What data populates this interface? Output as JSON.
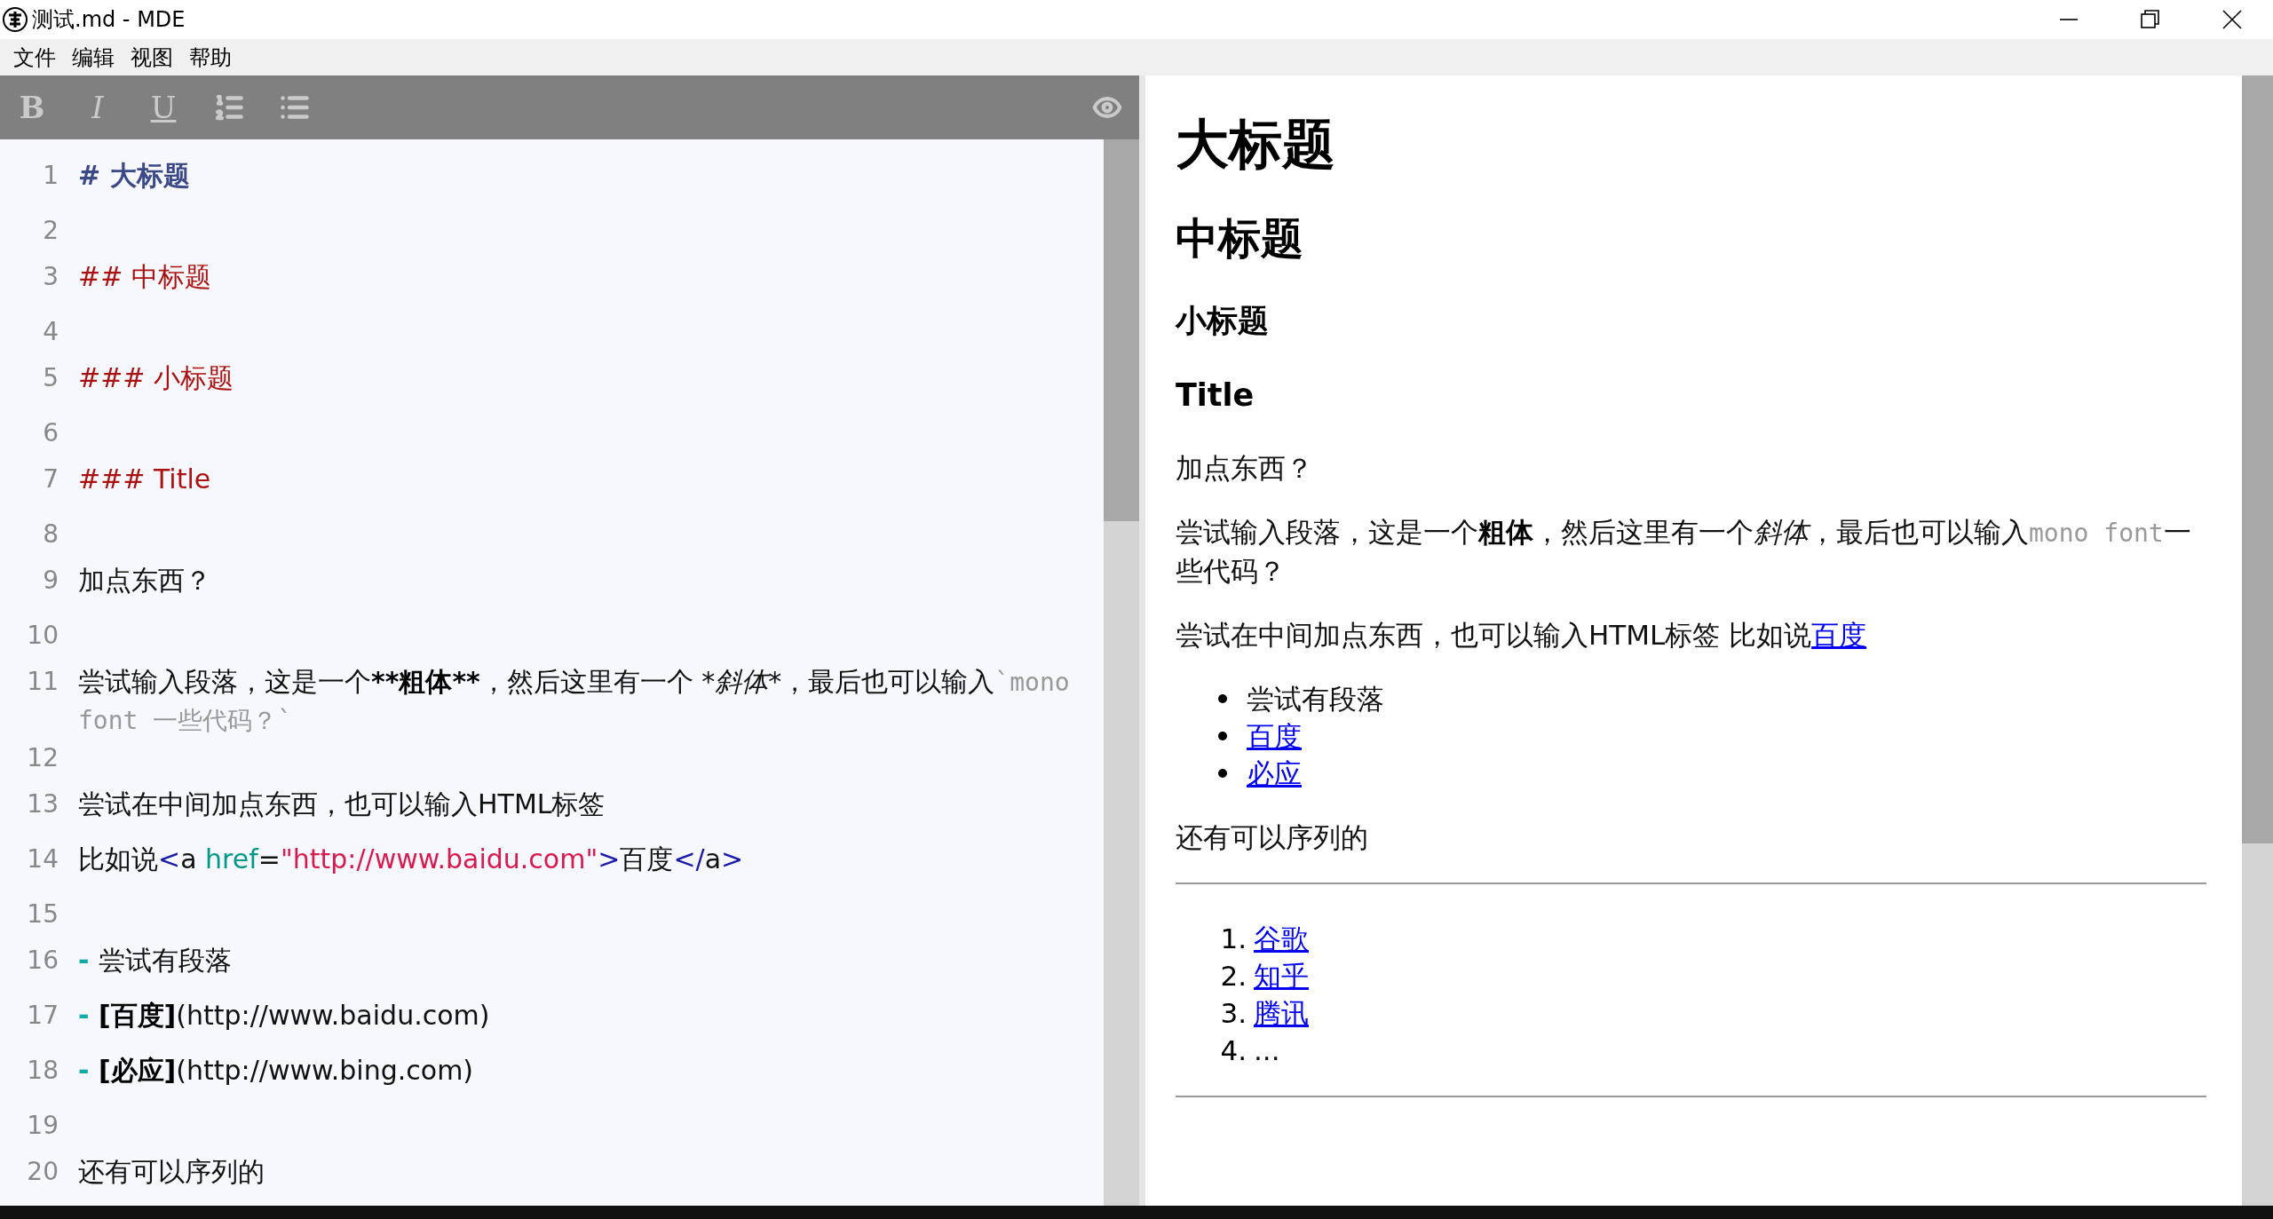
{
  "window": {
    "title": "测试.md - MDE"
  },
  "menu": [
    "文件",
    "编辑",
    "视图",
    "帮助"
  ],
  "toolbar": {
    "buttons": [
      {
        "kind": "bold",
        "label": "B"
      },
      {
        "kind": "italic",
        "label": "I"
      },
      {
        "kind": "underline",
        "label": "U"
      },
      {
        "kind": "ordered-list"
      },
      {
        "kind": "bullet-list"
      }
    ],
    "preview_toggle": {
      "kind": "eye"
    }
  },
  "editor": {
    "lines": [
      {
        "number": "1",
        "segments": [
          {
            "text": "# 大标题",
            "kind": "h1"
          }
        ]
      },
      {
        "number": "2"
      },
      {
        "number": "3",
        "segments": [
          {
            "text": "## 中标题",
            "kind": "header"
          }
        ]
      },
      {
        "number": "4"
      },
      {
        "number": "5",
        "segments": [
          {
            "text": "### 小标题",
            "kind": "header"
          }
        ]
      },
      {
        "number": "6"
      },
      {
        "number": "7",
        "segments": [
          {
            "text": "### Title",
            "kind": "header"
          }
        ]
      },
      {
        "number": "8"
      },
      {
        "number": "9",
        "segments": [
          {
            "text": "加点东西？",
            "kind": "plain"
          }
        ]
      },
      {
        "number": "10"
      },
      {
        "number": "11",
        "segments": [
          {
            "text": "尝试输入段落，这是一个",
            "kind": "plain"
          },
          {
            "text": "**粗体**",
            "kind": "bold"
          },
          {
            "text": "，然后这里有一个 ",
            "kind": "plain"
          },
          {
            "text": "*斜体*",
            "kind": "italic"
          },
          {
            "text": "，最后也可以输入",
            "kind": "plain"
          },
          {
            "text": "`mono font 一些代码？`",
            "kind": "code"
          }
        ]
      },
      {
        "number": "12"
      },
      {
        "number": "13",
        "segments": [
          {
            "text": "尝试在中间加点东西，也可以输入HTML标签",
            "kind": "plain"
          }
        ]
      },
      {
        "number": "14",
        "segments": [
          {
            "text": "比如说",
            "kind": "plain"
          },
          {
            "text": "<",
            "kind": "tag"
          },
          {
            "text": "a ",
            "kind": "plain"
          },
          {
            "text": "href",
            "kind": "attr"
          },
          {
            "text": "=",
            "kind": "plain"
          },
          {
            "text": "\"http://www.baidu.com\"",
            "kind": "string"
          },
          {
            "text": ">",
            "kind": "tag"
          },
          {
            "text": "百度",
            "kind": "plain"
          },
          {
            "text": "</",
            "kind": "tag"
          },
          {
            "text": "a",
            "kind": "plain"
          },
          {
            "text": ">",
            "kind": "tag"
          }
        ]
      },
      {
        "number": "15"
      },
      {
        "number": "16",
        "segments": [
          {
            "text": "- ",
            "kind": "marker"
          },
          {
            "text": "尝试有段落",
            "kind": "plain"
          }
        ]
      },
      {
        "number": "17",
        "segments": [
          {
            "text": "- ",
            "kind": "marker"
          },
          {
            "text": "[百度]",
            "kind": "bold"
          },
          {
            "text": "(http://www.baidu.com)",
            "kind": "plain"
          }
        ]
      },
      {
        "number": "18",
        "segments": [
          {
            "text": "- ",
            "kind": "marker"
          },
          {
            "text": "[必应]",
            "kind": "bold"
          },
          {
            "text": "(http://www.bing.com)",
            "kind": "plain"
          }
        ]
      },
      {
        "number": "19"
      },
      {
        "number": "20",
        "segments": [
          {
            "text": "还有可以序列的",
            "kind": "plain"
          }
        ]
      }
    ]
  },
  "preview": {
    "blocks": [
      {
        "kind": "h1",
        "text": "大标题"
      },
      {
        "kind": "h2",
        "text": "中标题"
      },
      {
        "kind": "h3",
        "text": "小标题"
      },
      {
        "kind": "h3",
        "text": "Title"
      },
      {
        "kind": "paragraph",
        "segments": [
          {
            "text": "加点东西？",
            "kind": "plain"
          }
        ]
      },
      {
        "kind": "paragraph",
        "segments": [
          {
            "text": "尝试输入段落，这是一个",
            "kind": "plain"
          },
          {
            "text": "粗体",
            "kind": "bold"
          },
          {
            "text": "，然后这里有一个",
            "kind": "plain"
          },
          {
            "text": "斜体",
            "kind": "italic"
          },
          {
            "text": "，最后也可以输入",
            "kind": "plain"
          },
          {
            "text": "mono font",
            "kind": "code"
          },
          {
            "text": "一些代码？",
            "kind": "plain"
          }
        ]
      },
      {
        "kind": "paragraph",
        "segments": [
          {
            "text": "尝试在中间加点东西，也可以输入HTML标签 比如说",
            "kind": "plain"
          },
          {
            "text": "百度",
            "kind": "link"
          }
        ]
      },
      {
        "kind": "bullets",
        "items": [
          {
            "text": "尝试有段落",
            "link": false
          },
          {
            "text": "百度",
            "link": true
          },
          {
            "text": "必应",
            "link": true
          }
        ]
      },
      {
        "kind": "paragraph",
        "segments": [
          {
            "text": "还有可以序列的",
            "kind": "plain"
          }
        ]
      },
      {
        "kind": "rule"
      },
      {
        "kind": "numbered",
        "items": [
          {
            "marker": "1.",
            "text": "谷歌",
            "link": true
          },
          {
            "marker": "2.",
            "text": "知乎",
            "link": true
          },
          {
            "marker": "3.",
            "text": "腾讯",
            "link": true
          },
          {
            "marker": "4.",
            "text": "...",
            "link": false
          }
        ]
      },
      {
        "kind": "rule"
      }
    ]
  }
}
